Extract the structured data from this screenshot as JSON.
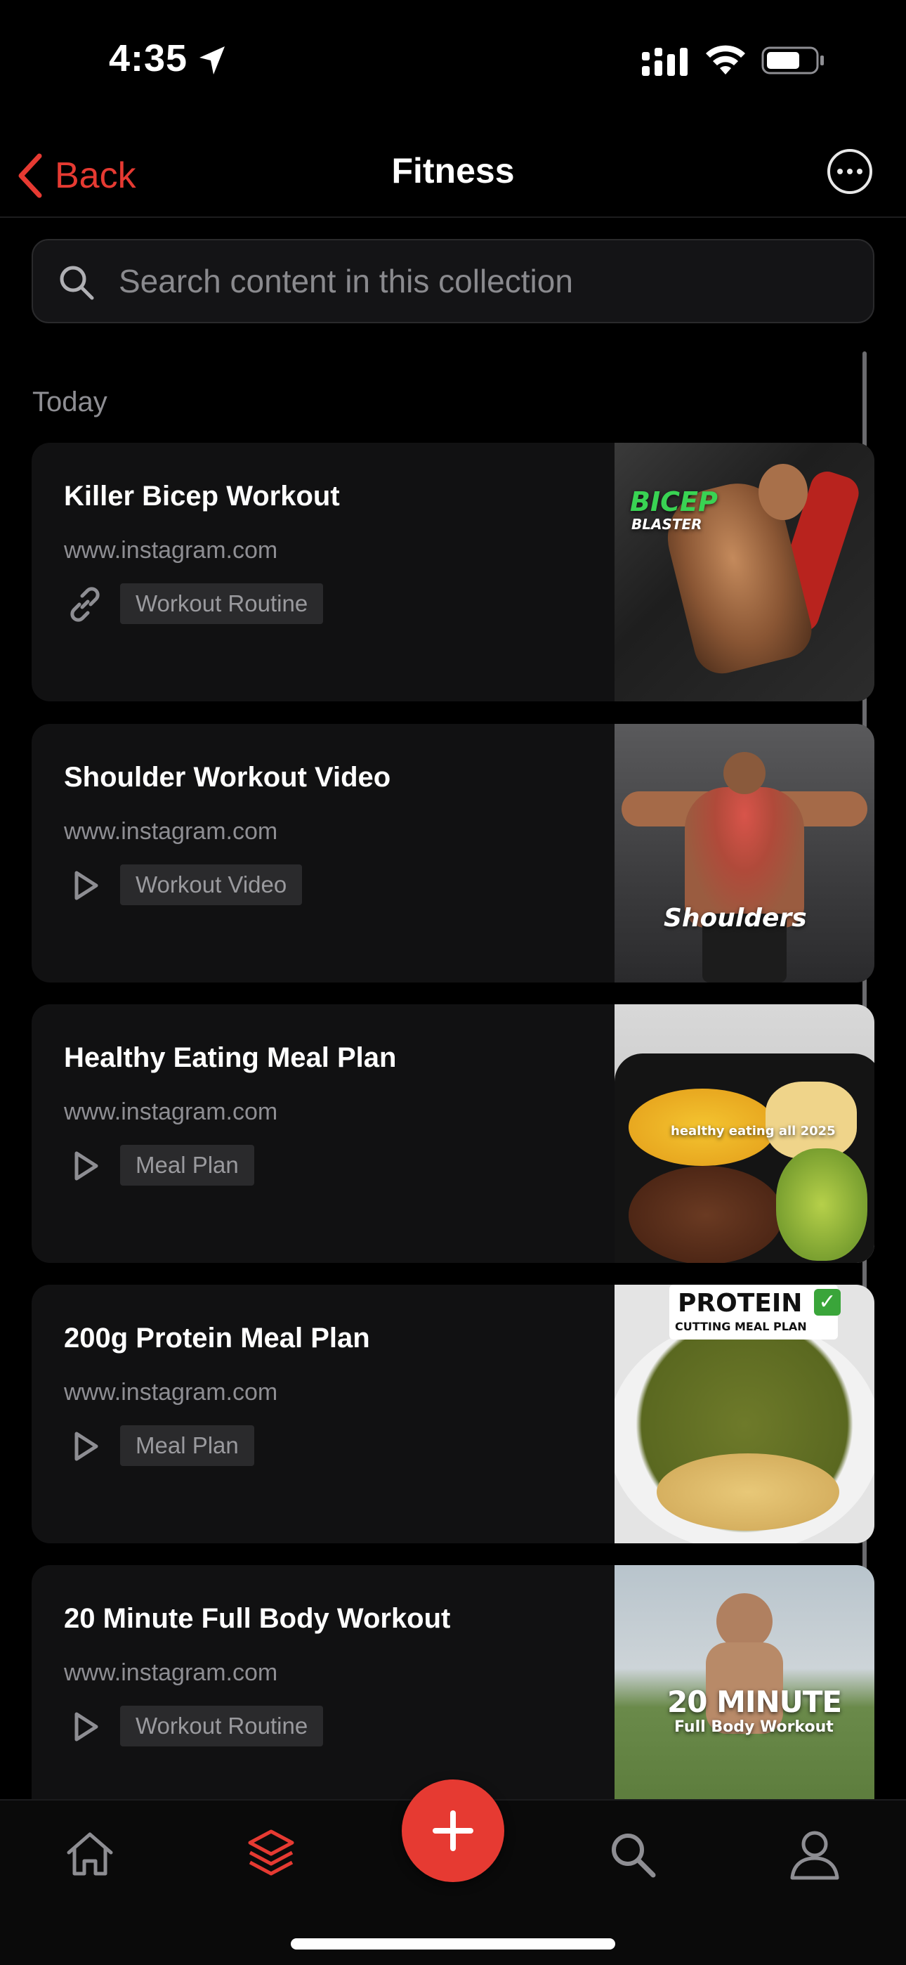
{
  "status_bar": {
    "time": "4:35"
  },
  "nav": {
    "back_label": "Back",
    "title": "Fitness"
  },
  "search": {
    "placeholder": "Search content in this collection",
    "value": ""
  },
  "section": {
    "label": "Today"
  },
  "items": [
    {
      "title": "Killer Bicep Workout",
      "domain": "www.instagram.com",
      "type_icon": "link-icon",
      "tag": "Workout Routine",
      "thumb_caption": "BICEP",
      "thumb_caption2": "BLASTER"
    },
    {
      "title": "Shoulder Workout Video",
      "domain": "www.instagram.com",
      "type_icon": "play-icon",
      "tag": "Workout Video",
      "thumb_caption": "Shoulders"
    },
    {
      "title": "Healthy Eating Meal Plan",
      "domain": "www.instagram.com",
      "type_icon": "play-icon",
      "tag": "Meal Plan",
      "thumb_caption": "healthy eating all 2025"
    },
    {
      "title": "200g Protein Meal Plan",
      "domain": "www.instagram.com",
      "type_icon": "play-icon",
      "tag": "Meal Plan",
      "thumb_caption": "PROTEIN",
      "thumb_caption2": "CUTTING MEAL PLAN"
    },
    {
      "title": "20 Minute Full Body Workout",
      "domain": "www.instagram.com",
      "type_icon": "play-icon",
      "tag": "Workout Routine",
      "thumb_caption": "20 MINUTE",
      "thumb_caption2": "Full Body Workout"
    }
  ],
  "tab_bar": {
    "tabs": [
      {
        "icon": "home-icon",
        "active": false
      },
      {
        "icon": "collections-icon",
        "active": true
      },
      {
        "icon": "add-icon",
        "active": false
      },
      {
        "icon": "search-icon",
        "active": false
      },
      {
        "icon": "profile-icon",
        "active": false
      }
    ]
  },
  "colors": {
    "accent": "#e63a32",
    "background": "#000000",
    "card": "#111112",
    "muted": "#8e8e93"
  }
}
